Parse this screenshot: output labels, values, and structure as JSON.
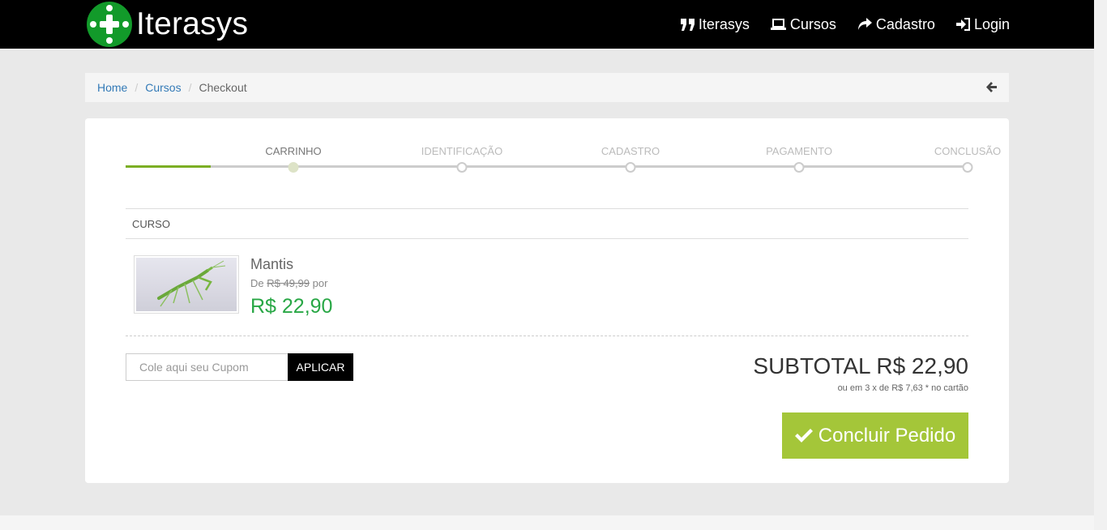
{
  "brand": {
    "name": "Iterasys",
    "logo_color": "#129a2a"
  },
  "nav": {
    "items": [
      {
        "icon": "quote-icon",
        "label": "Iterasys"
      },
      {
        "icon": "laptop-icon",
        "label": "Cursos"
      },
      {
        "icon": "share-icon",
        "label": "Cadastro"
      },
      {
        "icon": "login-icon",
        "label": "Login"
      }
    ]
  },
  "breadcrumb": {
    "home": "Home",
    "cursos": "Cursos",
    "current": "Checkout",
    "back_icon": "arrow-left-icon"
  },
  "steps": {
    "labels": [
      "CARRINHO",
      "IDENTIFICAÇÃO",
      "CADASTRO",
      "PAGAMENTO",
      "CONCLUSÃO"
    ],
    "current_index": 0,
    "accent": "#7cae24"
  },
  "cart": {
    "column_header": "CURSO",
    "item": {
      "name": "Mantis",
      "old_price_prefix": "De",
      "old_price": "R$ 49,99",
      "old_price_suffix": "por",
      "price": "R$ 22,90"
    }
  },
  "coupon": {
    "placeholder": "Cole aqui seu Cupom",
    "button": "APLICAR"
  },
  "summary": {
    "subtotal": "SUBTOTAL R$ 22,90",
    "installments": "ou em 3 x de R$ 7,63 * no cartão",
    "finish_button": "Concluir Pedido",
    "finish_icon": "check-icon",
    "finish_color": "#a4c639"
  }
}
